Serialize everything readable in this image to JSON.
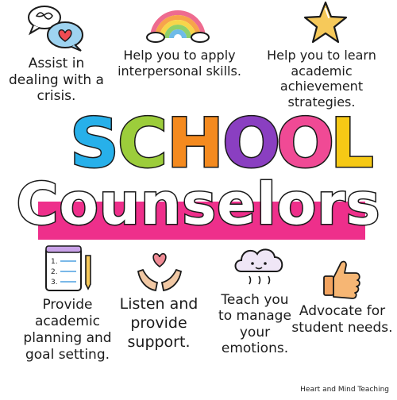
{
  "title": {
    "word1_letters": [
      "S",
      "C",
      "H",
      "O",
      "O",
      "L"
    ],
    "word1_colors": [
      "#27b0ea",
      "#9ccd3b",
      "#f48a1f",
      "#8a3fc1",
      "#f04a95",
      "#f6c915"
    ],
    "word2": "Counselors",
    "band_color": "#ee2f8b"
  },
  "items": [
    {
      "icon": "speech-bubbles-heart-icon",
      "lines": [
        "Assist in",
        "dealing with a",
        "crisis."
      ]
    },
    {
      "icon": "rainbow-icon",
      "lines": [
        "Help you to apply",
        "interpersonal skills."
      ]
    },
    {
      "icon": "star-icon",
      "lines": [
        "Help you to learn",
        "academic achievement",
        "strategies."
      ]
    },
    {
      "icon": "checklist-pencil-icon",
      "lines": [
        "Provide",
        "academic",
        "planning and",
        "goal setting."
      ]
    },
    {
      "icon": "hands-heart-icon",
      "lines": [
        "Listen and",
        "provide",
        "support."
      ]
    },
    {
      "icon": "cloud-face-icon",
      "lines": [
        "Teach you",
        "to manage",
        "your",
        "emotions."
      ]
    },
    {
      "icon": "thumbs-up-icon",
      "lines": [
        "Advocate for",
        "student needs."
      ]
    }
  ],
  "credit": "Heart and Mind Teaching"
}
